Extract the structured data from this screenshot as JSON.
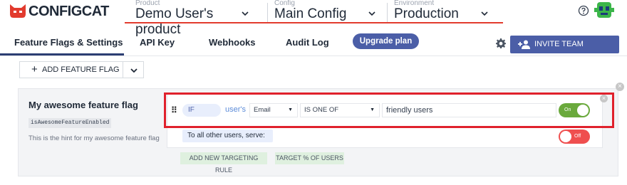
{
  "header": {
    "logo_text": "CONFIGCAT",
    "product": {
      "label": "Product",
      "value": "Demo User's product"
    },
    "config": {
      "label": "Config",
      "value": "Main Config"
    },
    "environment": {
      "label": "Environment",
      "value": "Production"
    },
    "accent_color": "#e23b2e"
  },
  "tabs": [
    {
      "label": "Feature Flags & Settings",
      "active": true
    },
    {
      "label": "API Key"
    },
    {
      "label": "Webhooks"
    },
    {
      "label": "Audit Log"
    }
  ],
  "upgrade_label": "Upgrade plan",
  "invite_label": "INVITE TEAM MEMBERS",
  "add_flag_label": "ADD FEATURE FLAG",
  "flag": {
    "name": "My awesome feature flag",
    "key": "isAwesomeFeatureEnabled",
    "hint": "This is the hint for my awesome feature flag"
  },
  "rule": {
    "if_label": "IF",
    "users_label": "user's",
    "attribute": "Email",
    "comparator": "IS ONE OF",
    "comparison_value": "friendly users",
    "serve_on": true,
    "serve_label": "On"
  },
  "default_rule": {
    "label": "To all other users, serve:",
    "serve_on": false,
    "serve_label": "Off"
  },
  "actions": {
    "add_rule": "ADD NEW TARGETING RULE",
    "target_percent": "TARGET % OF USERS"
  },
  "colors": {
    "primary": "#4b5ea7",
    "toggle_on": "#6aa93c",
    "toggle_off": "#ef4f4f",
    "highlight": "#e0212c"
  }
}
